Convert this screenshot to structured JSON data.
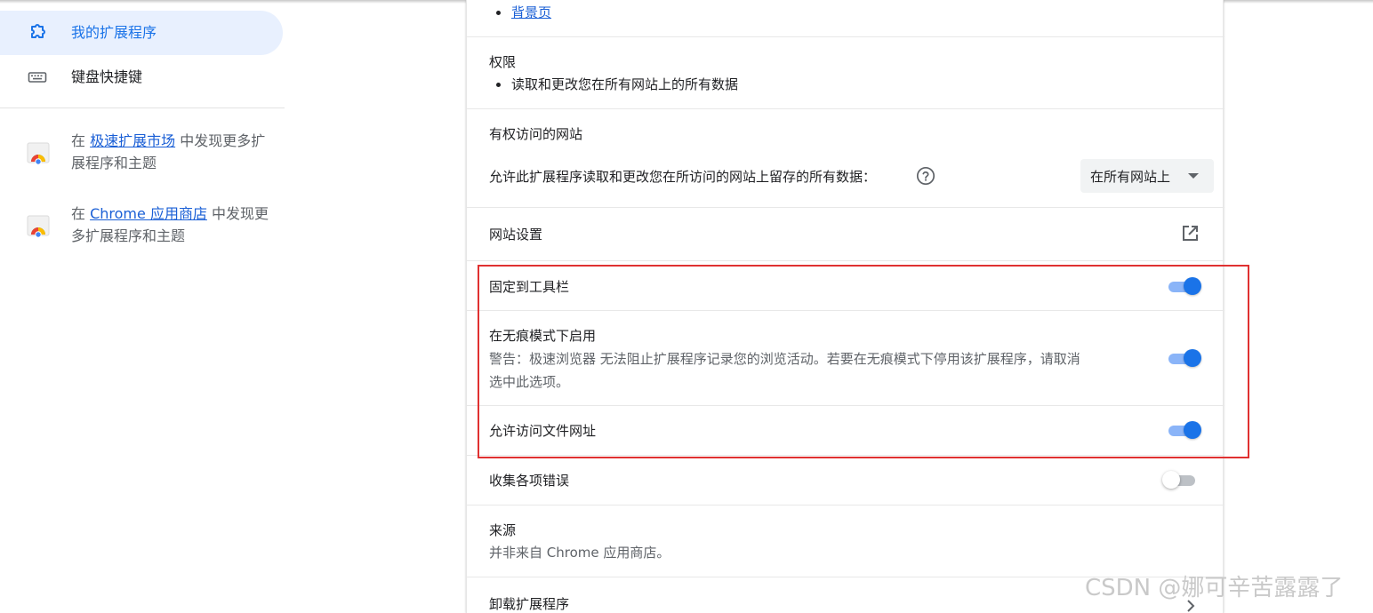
{
  "sidebar": {
    "items": [
      {
        "label": "我的扩展程序",
        "icon": "extension-icon",
        "active": true
      },
      {
        "label": "键盘快捷键",
        "icon": "keyboard-icon",
        "active": false
      }
    ],
    "promos": [
      {
        "prefix": "在 ",
        "link": "极速扩展市场",
        "suffix": " 中发现更多扩展程序和主题",
        "icon": "store-icon"
      },
      {
        "prefix": "在 ",
        "link": "Chrome 应用商店",
        "suffix": " 中发现更多扩展程序和主题",
        "icon": "chrome-store-icon"
      }
    ]
  },
  "details": {
    "views": {
      "link": "背景页"
    },
    "permissions": {
      "title": "权限",
      "item": "读取和更改您在所有网站上的所有数据"
    },
    "site_access": {
      "title": "有权访问的网站",
      "description": "允许此扩展程序读取和更改您在所访问的网站上留存的所有数据：",
      "select_value": "在所有网站上"
    },
    "site_settings": {
      "title": "网站设置"
    },
    "pin_toolbar": {
      "title": "固定到工具栏",
      "enabled": true
    },
    "incognito": {
      "title": "在无痕模式下启用",
      "warning_line1": "警告：极速浏览器 无法阻止扩展程序记录您的浏览活动。若要在无痕模式下停用该扩展程序，请取消",
      "warning_line2": "选中此选项。",
      "enabled": true
    },
    "file_urls": {
      "title": "允许访问文件网址",
      "enabled": true
    },
    "collect_errors": {
      "title": "收集各项错误",
      "enabled": false
    },
    "source": {
      "title": "来源",
      "value": "并非来自 Chrome 应用商店。"
    },
    "uninstall": {
      "title": "卸载扩展程序"
    }
  },
  "colors": {
    "accent": "#1a73e8",
    "highlight_border": "#e03131"
  },
  "watermark": "CSDN @娜可辛苦露露了"
}
